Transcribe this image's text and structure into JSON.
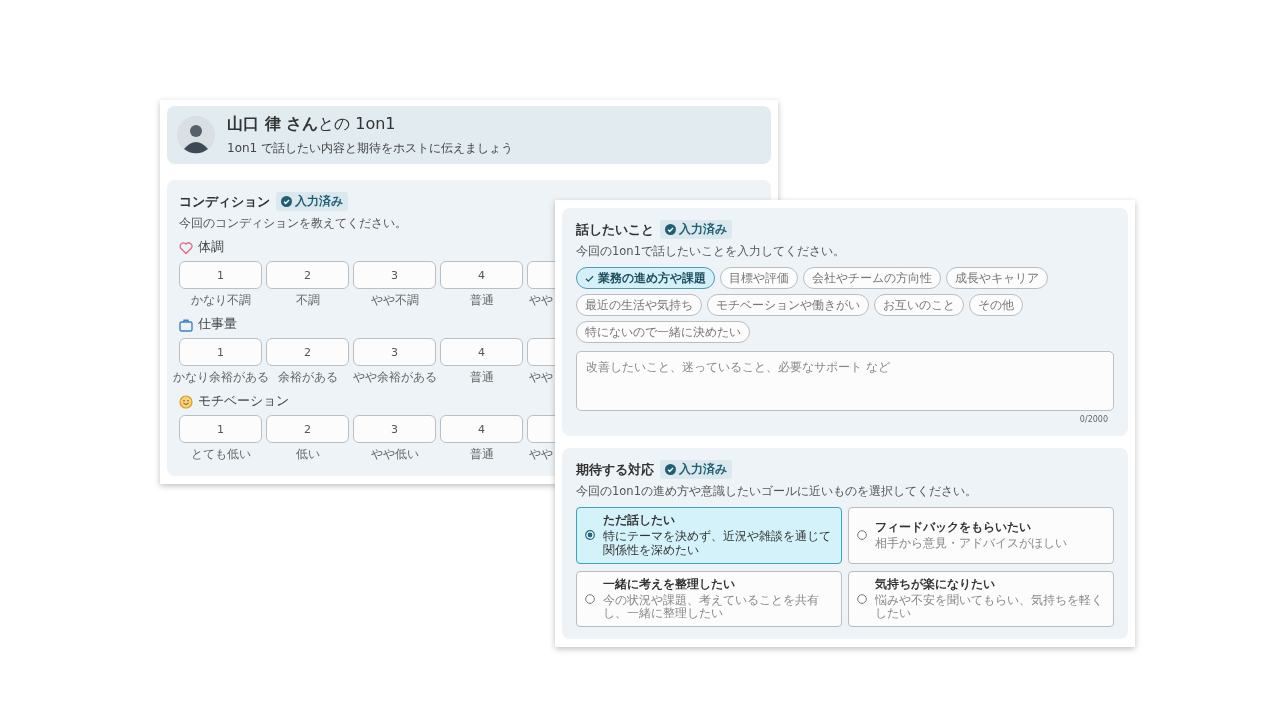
{
  "header": {
    "title": "**山口 律 さん**との 1on1",
    "subtitle": "1on1 で話したい内容と期待をホストに伝えましょう"
  },
  "condition": {
    "title": "コンディション",
    "badge": "入力済み",
    "description": "今回のコンディションを教えてください。",
    "groups": [
      {
        "kind": "heart",
        "label": "体調",
        "options": [
          {
            "value": "1",
            "label": "かなり不調",
            "selected": false
          },
          {
            "value": "2",
            "label": "不調",
            "selected": false
          },
          {
            "value": "3",
            "label": "やや不調",
            "selected": false
          },
          {
            "value": "4",
            "label": "普通",
            "selected": false
          },
          {
            "label": "やや",
            "selected": false
          }
        ]
      },
      {
        "kind": "briefcase",
        "label": "仕事量",
        "options": [
          {
            "value": "1",
            "label": "かなり余裕がある",
            "selected": false
          },
          {
            "value": "2",
            "label": "余裕がある",
            "selected": false
          },
          {
            "value": "3",
            "label": "やや余裕がある",
            "selected": false
          },
          {
            "value": "4",
            "label": "普通",
            "selected": false
          },
          {
            "label": "やや",
            "selected": false
          }
        ]
      },
      {
        "kind": "smiley",
        "label": "モチベーション",
        "options": [
          {
            "value": "1",
            "label": "とても低い",
            "selected": false
          },
          {
            "value": "2",
            "label": "低い",
            "selected": false
          },
          {
            "value": "3",
            "label": "やや低い",
            "selected": false
          },
          {
            "value": "4",
            "label": "普通",
            "selected": false
          },
          {
            "label": "やや",
            "selected": false
          }
        ]
      }
    ]
  },
  "topics": {
    "title": "話したいこと",
    "badge": "入力済み",
    "description": "今回の1on1で話したいことを入力してください。",
    "items": [
      {
        "label": "業務の進め方や課題",
        "selected": true
      },
      {
        "label": "目標や評価",
        "selected": false
      },
      {
        "label": "会社やチームの方向性",
        "selected": false
      },
      {
        "label": "成長やキャリア",
        "selected": false
      },
      {
        "label": "最近の生活や気持ち",
        "selected": false
      },
      {
        "label": "モチベーションや働きがい",
        "selected": false
      },
      {
        "label": "お互いのこと",
        "selected": false
      },
      {
        "label": "その他",
        "selected": false
      },
      {
        "label": "特にないので一緒に決めたい",
        "selected": false
      }
    ],
    "placeholder": "改善したいこと、迷っていること、必要なサポート など",
    "counter": "0/2000"
  },
  "expectation": {
    "title": "期待する対応",
    "badge": "入力済み",
    "description": "今回の1on1の進め方や意識したいゴールに近いものを選択してください。",
    "options": [
      {
        "title": "ただ話したい",
        "description": "特にテーマを決めず、近況や雑談を通じて関係性を深めたい",
        "selected": true
      },
      {
        "title": "フィードバックをもらいたい",
        "description": "相手から意見・アドバイスがほしい",
        "selected": false
      },
      {
        "title": "一緒に考えを整理したい",
        "description": "今の状況や課題、考えていることを共有し、一緒に整理したい",
        "selected": false
      },
      {
        "title": "気持ちが楽になりたい",
        "description": "悩みや不安を聞いてもらい、気持ちを軽くしたい",
        "selected": false
      }
    ]
  }
}
